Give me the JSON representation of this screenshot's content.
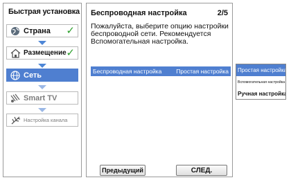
{
  "sidebar": {
    "title": "Быстрая установка",
    "steps": [
      {
        "label": "Страна",
        "icon": "globe-icon",
        "done": true
      },
      {
        "label": "Размещение",
        "icon": "house-icon",
        "done": true
      },
      {
        "label": "Сеть",
        "icon": "globe-icon",
        "active": true
      },
      {
        "label": "Smart TV",
        "icon": "smart-tv-icon"
      },
      {
        "label": "Настройка канала",
        "icon": "antenna-icon"
      }
    ],
    "check_glyph": "✓"
  },
  "main": {
    "title": "Беспроводная настройка",
    "page": "2/5",
    "description": "Пожалуйста, выберите опцию настройки беспроводной сети. Рекомендуется Вспомогательная настройка.",
    "option_label": "Беспроводная настройка",
    "option_value": "Простая настройка",
    "prev_label": "Предыдущий",
    "next_label": "СЛЕД."
  },
  "dropdown": {
    "options": [
      "Простая настройка",
      "Вспомогательная настройка",
      "Ручная настройка"
    ],
    "selected": "Простая настройка"
  },
  "colors": {
    "accent": "#4f7fd0",
    "check": "#2ea02e"
  }
}
